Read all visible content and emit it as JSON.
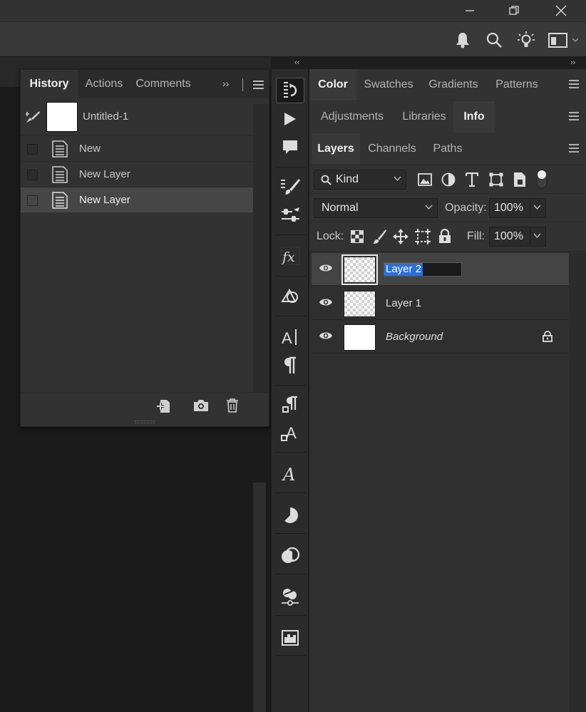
{
  "history_panel": {
    "tabs": [
      "History",
      "Actions",
      "Comments"
    ],
    "snapshot_label": "Untitled-1",
    "steps": [
      {
        "label": "New"
      },
      {
        "label": "New Layer"
      },
      {
        "label": "New Layer"
      }
    ]
  },
  "color_group": {
    "tabs": [
      "Color",
      "Swatches",
      "Gradients",
      "Patterns"
    ]
  },
  "adjust_group": {
    "tabs": [
      "Adjustments",
      "Libraries",
      "Info"
    ]
  },
  "layers_panel": {
    "tabs": [
      "Layers",
      "Channels",
      "Paths"
    ],
    "filter_label": "Kind",
    "blend_mode": "Normal",
    "opacity_label": "Opacity:",
    "opacity_value": "100%",
    "lock_label": "Lock:",
    "fill_label": "Fill:",
    "fill_value": "100%",
    "layers": [
      {
        "name": "Layer 2"
      },
      {
        "name": "Layer 1"
      },
      {
        "name": "Background"
      }
    ]
  },
  "colors": {
    "accent": "#2c6fd6",
    "panel": "#323232",
    "canvas": "#1b1b1b"
  }
}
